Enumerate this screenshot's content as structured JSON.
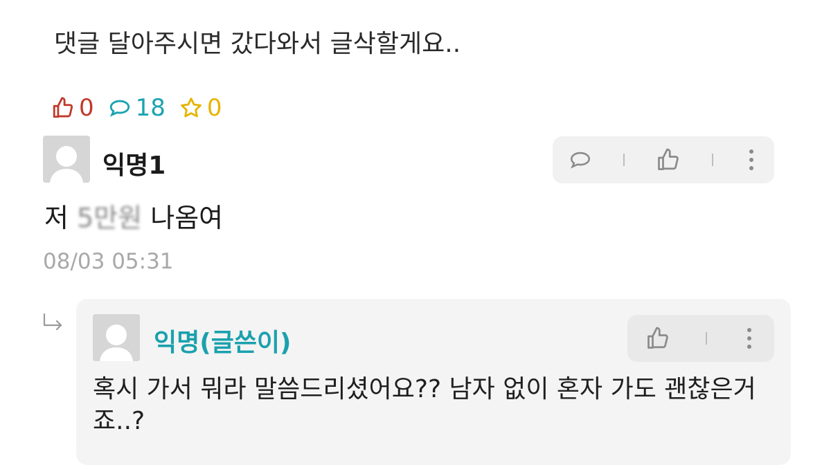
{
  "post": {
    "text": "댓글 달아주시면 갔다와서 글삭할게요.."
  },
  "stats": {
    "likes": "0",
    "comments": "18",
    "scraps": "0",
    "colors": {
      "like": "#c0392b",
      "comment": "#19a3b0",
      "scrap": "#e6b400"
    }
  },
  "comment1": {
    "author": "익명1",
    "text_before": "저 ",
    "text_blurred": "5만원",
    "text_after": " 나옴여",
    "date": "08/03 05:31"
  },
  "reply1": {
    "author": "익명(글쓴이)",
    "text": "혹시 가서 뭐라 말씀드리셨어요?? 남자 없이 혼자 가도 괜찮은거죠..?",
    "author_color": "#1aa1ad"
  }
}
